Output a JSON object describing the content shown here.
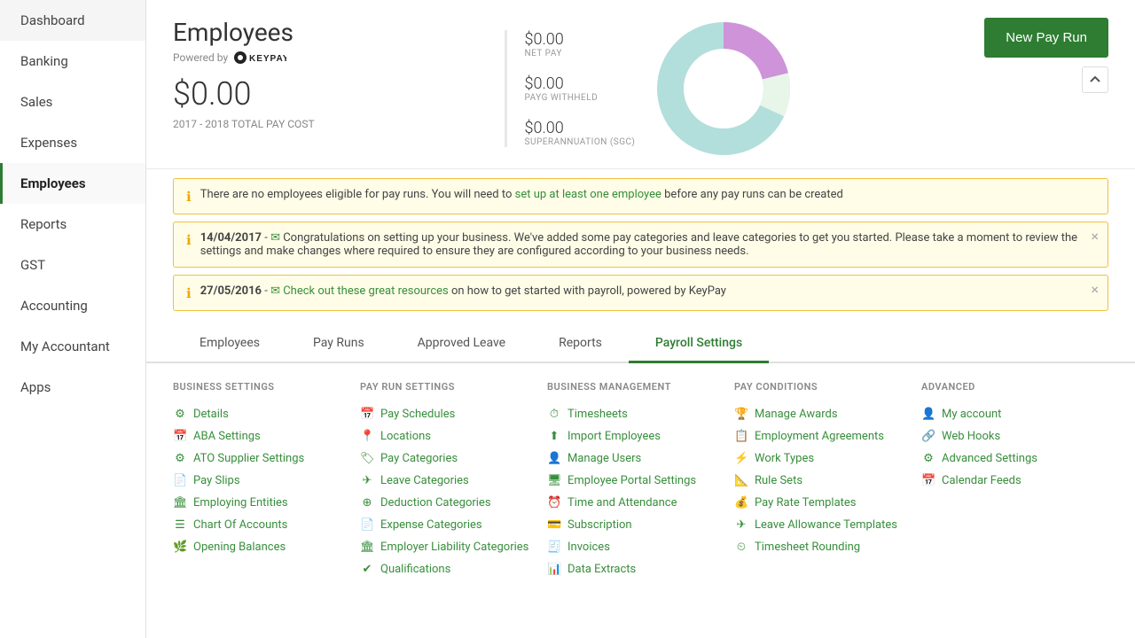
{
  "sidebar": {
    "items": [
      {
        "label": "Dashboard",
        "active": false
      },
      {
        "label": "Banking",
        "active": false
      },
      {
        "label": "Sales",
        "active": false
      },
      {
        "label": "Expenses",
        "active": false
      },
      {
        "label": "Employees",
        "active": true
      },
      {
        "label": "Reports",
        "active": false
      },
      {
        "label": "GST",
        "active": false
      },
      {
        "label": "Accounting",
        "active": false
      },
      {
        "label": "My Accountant",
        "active": false
      },
      {
        "label": "Apps",
        "active": false
      }
    ]
  },
  "header": {
    "title": "Employees",
    "powered_by": "Powered by",
    "keypay_label": "KEYPAY",
    "total_pay": "$0.00",
    "pay_period": "2017 - 2018 TOTAL PAY COST",
    "new_pay_run_label": "New Pay Run",
    "stats": [
      {
        "value": "$0.00",
        "label": "NET PAY"
      },
      {
        "value": "$0.00",
        "label": "PAYG WITHHELD"
      },
      {
        "value": "$0.00",
        "label": "SUPERANNUATION (SGC)"
      }
    ]
  },
  "notifications": [
    {
      "text_before": "There are no employees eligible for pay runs. You will need to ",
      "link_text": "set up at least one employee",
      "text_after": " before any pay runs can be created",
      "closable": false
    },
    {
      "date": "14/04/2017",
      "text_before": " Congratulations on setting up your business. We've added some pay categories and leave categories to get you started. Please take a moment to review the settings and make changes where required to ensure they are configured according to your business needs.",
      "closable": true
    },
    {
      "date": "27/05/2016",
      "link_text": "Check out these great resources",
      "text_after": " on how to get started with payroll, powered by KeyPay",
      "closable": true
    }
  ],
  "tabs": [
    {
      "label": "Employees",
      "active": false
    },
    {
      "label": "Pay Runs",
      "active": false
    },
    {
      "label": "Approved Leave",
      "active": false
    },
    {
      "label": "Reports",
      "active": false
    },
    {
      "label": "Payroll Settings",
      "active": true
    }
  ],
  "payroll_settings": {
    "business_settings": {
      "title": "BUSINESS SETTINGS",
      "items": [
        {
          "label": "Details",
          "icon": "gear"
        },
        {
          "label": "ABA Settings",
          "icon": "calendar"
        },
        {
          "label": "ATO Supplier Settings",
          "icon": "gear"
        },
        {
          "label": "Pay Slips",
          "icon": "doc"
        },
        {
          "label": "Employing Entities",
          "icon": "bank"
        },
        {
          "label": "Chart Of Accounts",
          "icon": "list"
        },
        {
          "label": "Opening Balances",
          "icon": "leaf"
        }
      ]
    },
    "pay_run_settings": {
      "title": "PAY RUN SETTINGS",
      "items": [
        {
          "label": "Pay Schedules",
          "icon": "calendar"
        },
        {
          "label": "Locations",
          "icon": "location"
        },
        {
          "label": "Pay Categories",
          "icon": "tag"
        },
        {
          "label": "Leave Categories",
          "icon": "plane"
        },
        {
          "label": "Deduction Categories",
          "icon": "circle"
        },
        {
          "label": "Expense Categories",
          "icon": "doc"
        },
        {
          "label": "Employer Liability Categories",
          "icon": "bank"
        },
        {
          "label": "Qualifications",
          "icon": "check"
        }
      ]
    },
    "business_management": {
      "title": "BUSINESS MANAGEMENT",
      "items": [
        {
          "label": "Timesheets",
          "icon": "clock"
        },
        {
          "label": "Import Employees",
          "icon": "import"
        },
        {
          "label": "Manage Users",
          "icon": "user"
        },
        {
          "label": "Employee Portal Settings",
          "icon": "portal"
        },
        {
          "label": "Time and Attendance",
          "icon": "time"
        },
        {
          "label": "Subscription",
          "icon": "sub"
        },
        {
          "label": "Invoices",
          "icon": "invoice"
        },
        {
          "label": "Data Extracts",
          "icon": "data"
        }
      ]
    },
    "pay_conditions": {
      "title": "PAY CONDITIONS",
      "items": [
        {
          "label": "Manage Awards",
          "icon": "trophy"
        },
        {
          "label": "Employment Agreements",
          "icon": "shield"
        },
        {
          "label": "Work Types",
          "icon": "type"
        },
        {
          "label": "Rule Sets",
          "icon": "rule"
        },
        {
          "label": "Pay Rate Templates",
          "icon": "rate"
        },
        {
          "label": "Leave Allowance Templates",
          "icon": "allow"
        },
        {
          "label": "Timesheet Rounding",
          "icon": "round"
        }
      ]
    },
    "advanced": {
      "title": "ADVANCED",
      "items": [
        {
          "label": "My account",
          "icon": "account"
        },
        {
          "label": "Web Hooks",
          "icon": "webhook"
        },
        {
          "label": "Advanced Settings",
          "icon": "adv"
        },
        {
          "label": "Calendar Feeds",
          "icon": "feed"
        }
      ]
    }
  },
  "colors": {
    "accent": "#2e7d32",
    "warning_bg": "#fffde7",
    "warning_border": "#f0c040"
  }
}
